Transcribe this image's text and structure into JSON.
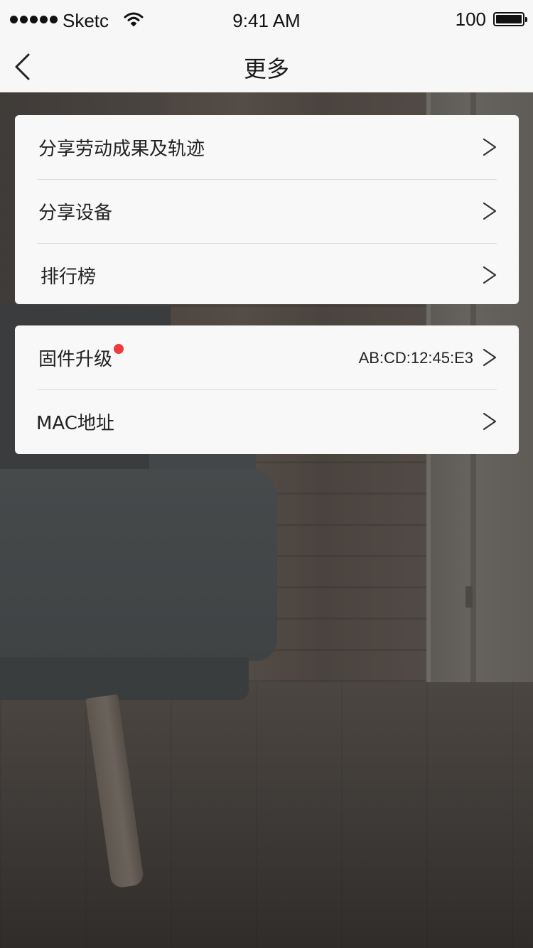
{
  "statusbar": {
    "carrier": "Sketc",
    "time": "9:41 AM",
    "battery_level": "100"
  },
  "navbar": {
    "title": "更多",
    "back_icon": "chevron-left-icon"
  },
  "card1": {
    "items": [
      {
        "label": "分享劳动成果及轨迹",
        "icon": "chevron-right-icon"
      },
      {
        "label": "分享设备",
        "icon": "chevron-right-icon"
      },
      {
        "label": "排行榜",
        "icon": "chevron-right-icon"
      }
    ]
  },
  "card2": {
    "items": [
      {
        "label": "固件升级",
        "value": "AB:CD:12:45:E3",
        "badge": "notification-dot",
        "badge_color": "#ee3b3e",
        "icon": "chevron-right-icon"
      },
      {
        "label": "MAC地址",
        "icon": "chevron-right-icon"
      }
    ]
  },
  "colors": {
    "bar_background": "#f7f7f7",
    "card_background": "#f8f8f8",
    "divider": "#dcdcdc",
    "badge": "#ee3b3e"
  }
}
